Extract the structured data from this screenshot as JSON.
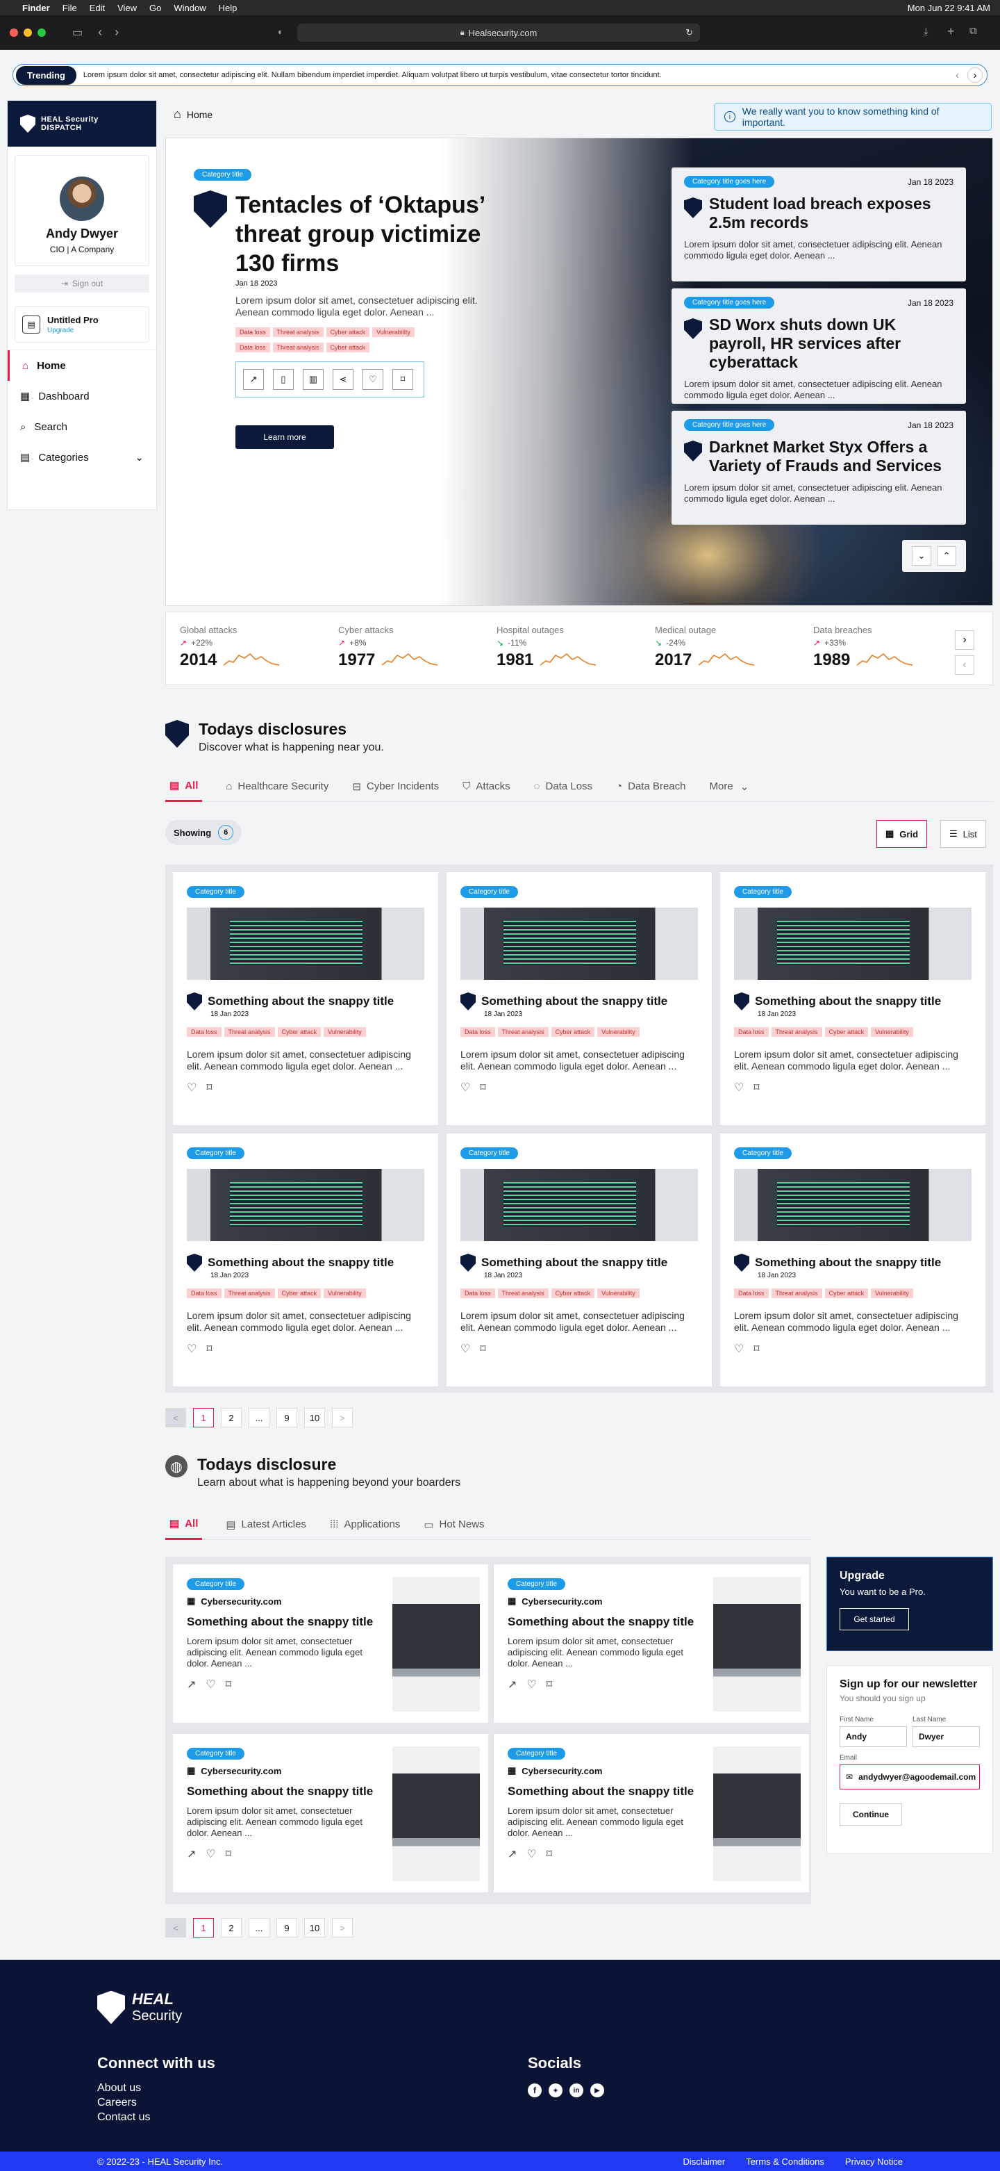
{
  "mac": {
    "apple": "",
    "finder": "Finder",
    "menus": [
      "File",
      "Edit",
      "View",
      "Go",
      "Window",
      "Help"
    ],
    "clock": "Mon Jun 22  9:41 AM"
  },
  "browser": {
    "url": "Healsecurity.com"
  },
  "trending": {
    "label": "Trending",
    "text": "Lorem ipsum dolor sit amet, consectetur adipiscing elit. Nullam bibendum imperdiet imperdiet. Aliquam volutpat libero ut turpis vestibulum, vitae consectetur tortor tincidunt."
  },
  "brand": {
    "line1": "HEAL Security",
    "line2": "DISPATCH"
  },
  "profile": {
    "name": "Andy Dwyer",
    "role": "CIO | A Company",
    "signout": "Sign out"
  },
  "plan": {
    "name": "Untitled Pro",
    "upgrade": "Upgrade"
  },
  "nav": [
    {
      "label": "Home"
    },
    {
      "label": "Dashboard"
    },
    {
      "label": "Search"
    },
    {
      "label": "Categories"
    }
  ],
  "breadcrumb": "Home",
  "notice": "We really want you to know something kind of important.",
  "hero": {
    "category": "Category title",
    "title": "Tentacles of ‘Oktapus’ threat group victimize 130 firms",
    "date": "Jan 18 2023",
    "desc": "Lorem ipsum dolor sit amet, consectetuer adipiscing elit. Aenean commodo ligula eget dolor. Aenean ...",
    "tags": [
      "Data loss",
      "Threat analysis",
      "Cyber attack",
      "Vulnerability",
      "Data loss",
      "Threat analysis",
      "Cyber attack"
    ],
    "cta": "Learn more"
  },
  "side_stories": [
    {
      "category": "Category title goes here",
      "date": "Jan 18 2023",
      "title": "Student load breach exposes 2.5m records",
      "desc": "Lorem ipsum dolor sit amet, consectetuer adipiscing elit. Aenean commodo ligula eget dolor. Aenean ..."
    },
    {
      "category": "Category title goes here",
      "date": "Jan 18 2023",
      "title": "SD Worx shuts down UK payroll, HR services after cyberattack",
      "desc": "Lorem ipsum dolor sit amet, consectetuer adipiscing elit. Aenean commodo ligula eget dolor. Aenean ..."
    },
    {
      "category": "Category title goes here",
      "date": "Jan 18 2023",
      "title": "Darknet Market Styx Offers a Variety of Frauds and Services",
      "desc": "Lorem ipsum dolor sit amet, consectetuer adipiscing elit. Aenean commodo ligula eget dolor. Aenean ..."
    }
  ],
  "stats": [
    {
      "label": "Global attacks",
      "delta": "+22%",
      "value": "2014",
      "trend": "up"
    },
    {
      "label": "Cyber attacks",
      "delta": "+8%",
      "value": "1977",
      "trend": "up"
    },
    {
      "label": "Hospital outages",
      "delta": "-11%",
      "value": "1981",
      "trend": "down"
    },
    {
      "label": "Medical outage",
      "delta": "-24%",
      "value": "2017",
      "trend": "down"
    },
    {
      "label": "Data breaches",
      "delta": "+33%",
      "value": "1989",
      "trend": "up"
    }
  ],
  "disclosures": {
    "title": "Todays disclosures",
    "subtitle": "Discover what is happening near you.",
    "tabs": [
      "All",
      "Healthcare Security",
      "Cyber Incidents",
      "Attacks",
      "Data Loss",
      "Data Breach",
      "More"
    ],
    "showing": "Showing",
    "count": "6",
    "grid": "Grid",
    "list": "List"
  },
  "card": {
    "category": "Category title",
    "title": "Something about the snappy title",
    "date": "18 Jan 2023",
    "tags": [
      "Data loss",
      "Threat analysis",
      "Cyber attack",
      "Vulnerability"
    ],
    "desc": "Lorem ipsum dolor sit amet, consectetuer adipiscing elit. Aenean commodo ligula eget dolor. Aenean ..."
  },
  "pager": [
    "<",
    "1",
    "2",
    "...",
    "9",
    "10",
    ">"
  ],
  "global": {
    "title": "Todays disclosure",
    "subtitle": "Learn about what is happening beyond your boarders",
    "tabs": [
      "All",
      "Latest Articles",
      "Applications",
      "Hot News"
    ]
  },
  "lcard": {
    "category": "Category title",
    "source": "Cybersecurity.com",
    "title": "Something about the snappy title",
    "desc": "Lorem ipsum dolor sit amet, consectetuer adipiscing elit. Aenean commodo ligula eget dolor. Aenean ..."
  },
  "upgrade": {
    "title": "Upgrade",
    "text": "You want to be a Pro.",
    "button": "Get started"
  },
  "newsletter": {
    "title": "Sign up for our newsletter",
    "subtitle": "You should you sign up",
    "first_label": "First Name",
    "first": "Andy",
    "last_label": "Last Name",
    "last": "Dwyer",
    "email_label": "Email",
    "email": "andydwyer@agoodemail.com",
    "button": "Continue"
  },
  "footer": {
    "logo1": "HEAL",
    "logo2": "Security",
    "connect": "Connect with us",
    "links": [
      "About us",
      "Careers",
      "Contact us"
    ],
    "socials": "Socials",
    "copyright": "© 2022-23 - HEAL Security Inc.",
    "legal": [
      "Disclaimer",
      "Terms & Conditions",
      "Privacy Notice"
    ]
  },
  "colors": {
    "navy": "#0b1a3a",
    "accent": "#e11d48",
    "blue": "#1e9be8",
    "footer": "#0b1435",
    "footbar": "#1f3af0"
  }
}
